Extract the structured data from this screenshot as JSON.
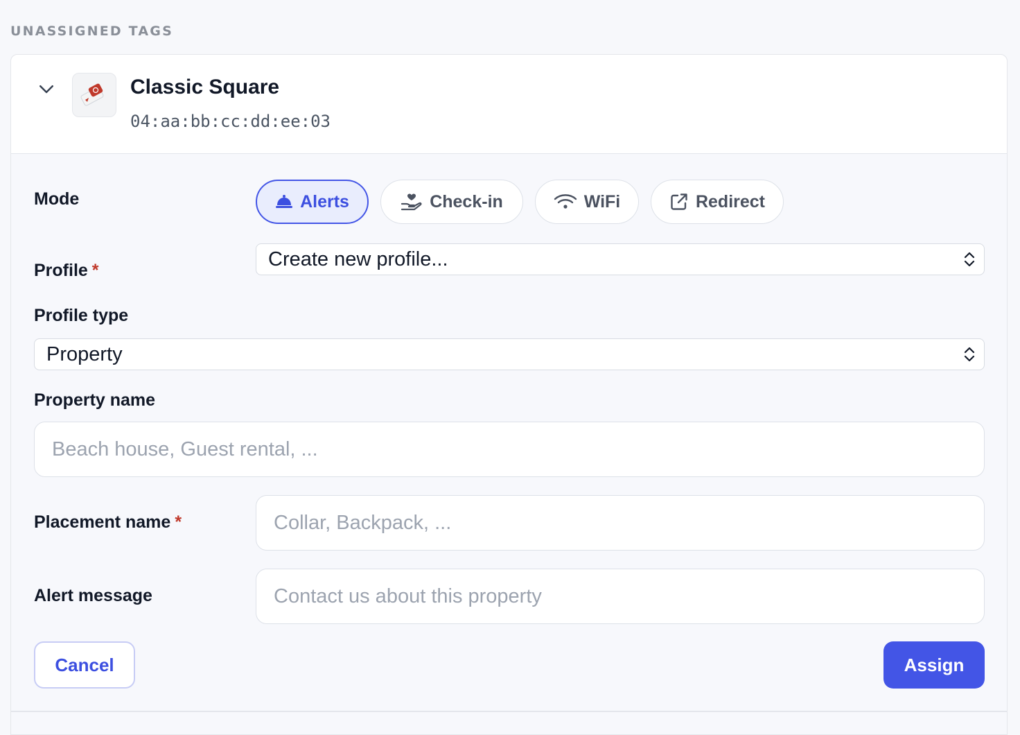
{
  "section": {
    "title": "UNASSIGNED TAGS"
  },
  "tag": {
    "name": "Classic Square",
    "uid": "04:aa:bb:cc:dd:ee:03"
  },
  "form": {
    "mode_label": "Mode",
    "modes": [
      {
        "label": "Alerts",
        "icon": "bell-icon",
        "active": true
      },
      {
        "label": "Check-in",
        "icon": "hand-heart-icon",
        "active": false
      },
      {
        "label": "WiFi",
        "icon": "wifi-icon",
        "active": false
      },
      {
        "label": "Redirect",
        "icon": "external-link-icon",
        "active": false
      }
    ],
    "profile_label": "Profile",
    "profile_required_mark": "*",
    "profile_value": "Create new profile...",
    "profile_type_label": "Profile type",
    "profile_type_value": "Property",
    "property_name_label": "Property name",
    "property_name_placeholder": "Beach house, Guest rental, ...",
    "placement_name_label": "Placement name",
    "placement_required_mark": "*",
    "placement_name_placeholder": "Collar, Backpack, ...",
    "alert_message_label": "Alert message",
    "alert_message_placeholder": "Contact us about this property"
  },
  "actions": {
    "cancel_label": "Cancel",
    "assign_label": "Assign"
  },
  "colors": {
    "accent": "#4355e6",
    "required": "#c0392b",
    "background": "#f7f8fc"
  }
}
